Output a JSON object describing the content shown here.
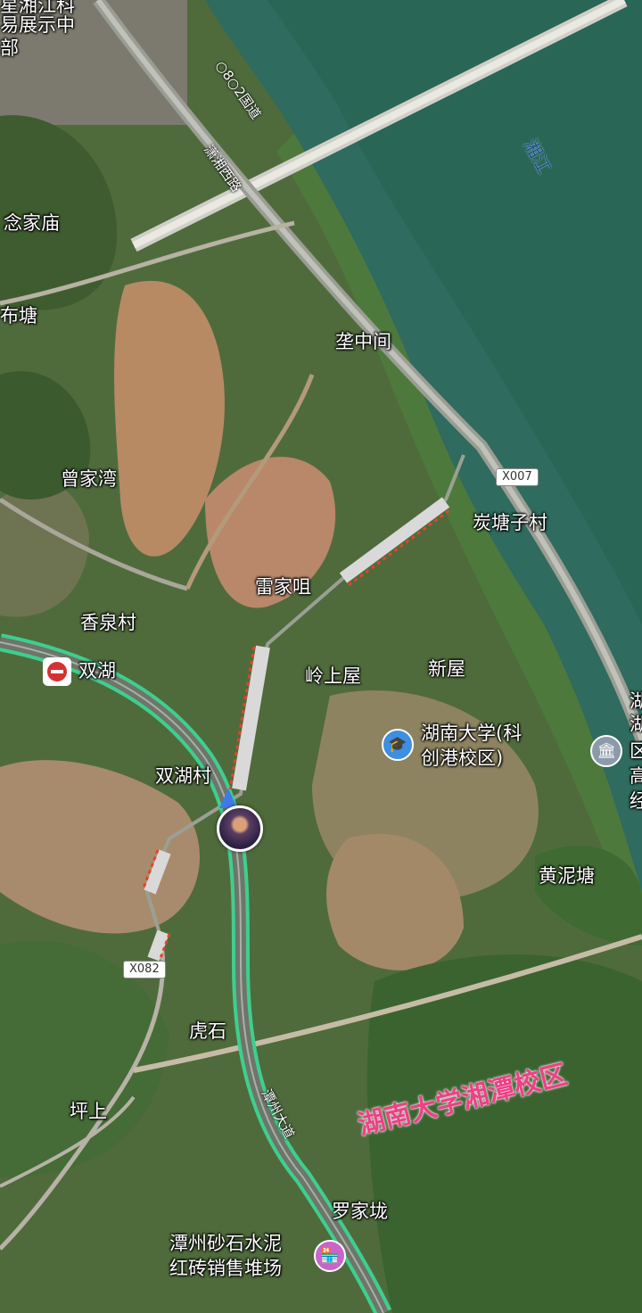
{
  "map": {
    "water_label": "湘江",
    "road_labels": [
      "潇湘西路",
      "○8○2国道",
      "潭州大道"
    ],
    "route_shields": [
      "X007",
      "X082"
    ],
    "place_labels": [
      "星湘江科",
      "易展示中",
      "部",
      "念家庙",
      "布塘",
      "垄中间",
      "曾家湾",
      "炭塘子村",
      "雷家咀",
      "香泉村",
      "双湖",
      "岭上屋",
      "新屋",
      "湖南大学(科",
      "创港校区)",
      "双湖村",
      "黄泥塘",
      "虎石",
      "坪上",
      "罗家垅",
      "潭州砂石水泥",
      "红砖销售堆场",
      "湖",
      "湖",
      "区",
      "高",
      "经"
    ],
    "annotation": "湖南大学湘潭校区",
    "colors": {
      "highway": "#3ecf8e",
      "planned_road": "#d9d9d9",
      "planned_edge": "#e0452a",
      "annotation": "#ef3f86"
    },
    "icons": {
      "metro": "metro-station-icon",
      "school": "school-icon",
      "gov": "government-icon",
      "shop": "shop-icon",
      "location": "current-location-marker"
    }
  }
}
